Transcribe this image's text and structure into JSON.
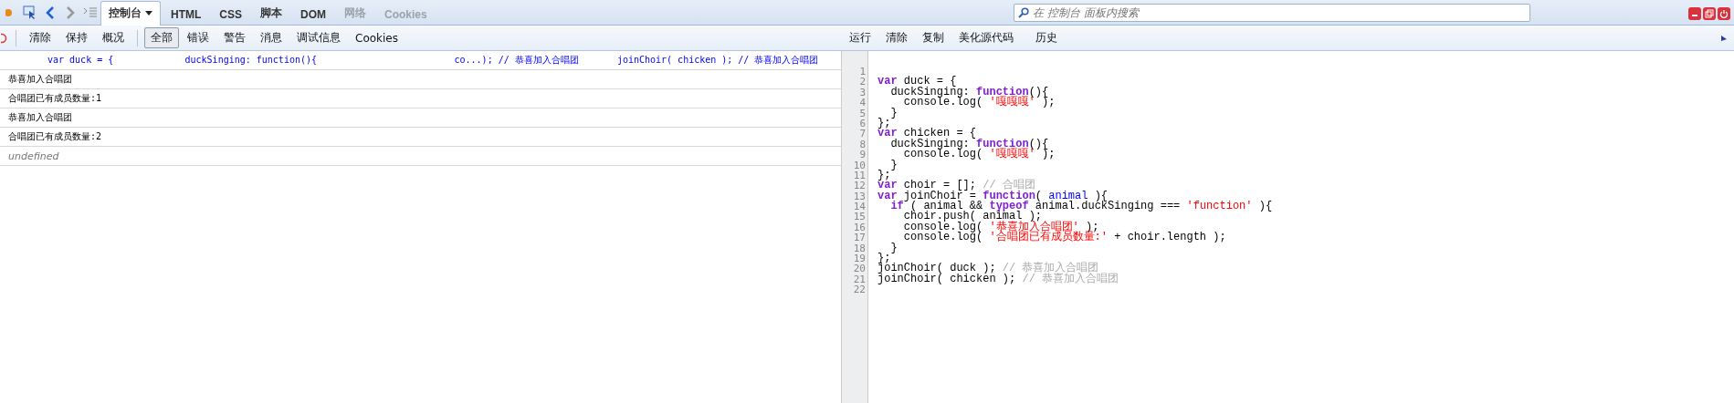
{
  "panel_tabs": [
    {
      "label": "控制台",
      "selected": true,
      "disabled": false,
      "menu": true
    },
    {
      "label": "HTML",
      "selected": false,
      "disabled": false,
      "menu": false
    },
    {
      "label": "CSS",
      "selected": false,
      "disabled": false,
      "menu": false
    },
    {
      "label": "脚本",
      "selected": false,
      "disabled": false,
      "menu": false
    },
    {
      "label": "DOM",
      "selected": false,
      "disabled": false,
      "menu": false
    },
    {
      "label": "网络",
      "selected": false,
      "disabled": true,
      "menu": false
    },
    {
      "label": "Cookies",
      "selected": false,
      "disabled": true,
      "menu": false
    }
  ],
  "search": {
    "placeholder": "在 控制台 面板内搜索"
  },
  "console_toolbar": {
    "actions": [
      "清除",
      "保持",
      "概况"
    ],
    "filters": [
      {
        "label": "全部",
        "selected": true
      },
      {
        "label": "错误",
        "selected": false
      },
      {
        "label": "警告",
        "selected": false
      },
      {
        "label": "消息",
        "selected": false
      },
      {
        "label": "调试信息",
        "selected": false
      },
      {
        "label": "Cookies",
        "selected": false
      }
    ]
  },
  "editor_toolbar": [
    "运行",
    "清除",
    "复制",
    "美化源代码",
    "历史"
  ],
  "console_rows": [
    {
      "kind": "command",
      "text": "var duck = {             duckSinging: function(){                         co...); // 恭喜加入合唱团       joinChoir( chicken ); // 恭喜加入合唱团"
    },
    {
      "kind": "log",
      "text": "恭喜加入合唱团"
    },
    {
      "kind": "log",
      "text": "合唱团已有成员数量:1"
    },
    {
      "kind": "log",
      "text": "恭喜加入合唱团"
    },
    {
      "kind": "log",
      "text": "合唱团已有成员数量:2"
    },
    {
      "kind": "result",
      "text": "undefined"
    }
  ],
  "editor": {
    "lines": [
      {
        "number": "1"
      },
      {
        "number": "2",
        "tokens": [
          {
            "kind": "kw",
            "text": "var"
          },
          {
            "kind": "plain",
            "text": " duck = {"
          }
        ]
      },
      {
        "number": "3",
        "tokens": [
          {
            "kind": "plain",
            "text": "  duckSinging: "
          },
          {
            "kind": "kw",
            "text": "function"
          },
          {
            "kind": "plain",
            "text": "(){"
          }
        ]
      },
      {
        "number": "4",
        "tokens": [
          {
            "kind": "plain",
            "text": "    console.log( "
          },
          {
            "kind": "str",
            "text": "'嘎嘎嘎'"
          },
          {
            "kind": "plain",
            "text": " );"
          }
        ]
      },
      {
        "number": "5",
        "tokens": [
          {
            "kind": "plain",
            "text": "  }"
          }
        ]
      },
      {
        "number": "6",
        "tokens": [
          {
            "kind": "plain",
            "text": "};"
          }
        ]
      },
      {
        "number": "7",
        "tokens": [
          {
            "kind": "kw",
            "text": "var"
          },
          {
            "kind": "plain",
            "text": " chicken = {"
          }
        ]
      },
      {
        "number": "8",
        "tokens": [
          {
            "kind": "plain",
            "text": "  duckSinging: "
          },
          {
            "kind": "kw",
            "text": "function"
          },
          {
            "kind": "plain",
            "text": "(){"
          }
        ]
      },
      {
        "number": "9",
        "tokens": [
          {
            "kind": "plain",
            "text": "    console.log( "
          },
          {
            "kind": "str",
            "text": "'嘎嘎嘎'"
          },
          {
            "kind": "plain",
            "text": " );"
          }
        ]
      },
      {
        "number": "10",
        "tokens": [
          {
            "kind": "plain",
            "text": "  }"
          }
        ]
      },
      {
        "number": "11",
        "tokens": [
          {
            "kind": "plain",
            "text": "};"
          }
        ]
      },
      {
        "number": "12",
        "tokens": [
          {
            "kind": "kw",
            "text": "var"
          },
          {
            "kind": "plain",
            "text": " choir = []; "
          },
          {
            "kind": "comment",
            "text": "// 合唱团"
          }
        ]
      },
      {
        "number": "13",
        "tokens": [
          {
            "kind": "kw",
            "text": "var"
          },
          {
            "kind": "plain",
            "text": " joinChoir = "
          },
          {
            "kind": "kw",
            "text": "function"
          },
          {
            "kind": "plain",
            "text": "( "
          },
          {
            "kind": "param",
            "text": "animal"
          },
          {
            "kind": "plain",
            "text": " ){"
          }
        ]
      },
      {
        "number": "14",
        "tokens": [
          {
            "kind": "kw",
            "text": "  if"
          },
          {
            "kind": "plain",
            "text": " ( animal && "
          },
          {
            "kind": "kw",
            "text": "typeof"
          },
          {
            "kind": "plain",
            "text": " animal.duckSinging === "
          },
          {
            "kind": "str",
            "text": "'function'"
          },
          {
            "kind": "plain",
            "text": " ){"
          }
        ]
      },
      {
        "number": "15",
        "tokens": [
          {
            "kind": "plain",
            "text": "    choir.push( animal );"
          }
        ]
      },
      {
        "number": "16",
        "tokens": [
          {
            "kind": "plain",
            "text": "    console.log( "
          },
          {
            "kind": "str",
            "text": "'恭喜加入合唱团'"
          },
          {
            "kind": "plain",
            "text": " );"
          }
        ]
      },
      {
        "number": "17",
        "tokens": [
          {
            "kind": "plain",
            "text": "    console.log( "
          },
          {
            "kind": "str",
            "text": "'合唱团已有成员数量:'"
          },
          {
            "kind": "plain",
            "text": " + choir.length );"
          }
        ]
      },
      {
        "number": "18",
        "tokens": [
          {
            "kind": "plain",
            "text": "  }"
          }
        ]
      },
      {
        "number": "19",
        "tokens": [
          {
            "kind": "plain",
            "text": "};"
          }
        ]
      },
      {
        "number": "20",
        "tokens": [
          {
            "kind": "plain",
            "text": "joinChoir( duck ); "
          },
          {
            "kind": "comment",
            "text": "// 恭喜加入合唱团"
          }
        ]
      },
      {
        "number": "21",
        "tokens": [
          {
            "kind": "plain",
            "text": "joinChoir( chicken ); "
          },
          {
            "kind": "comment",
            "text": "// 恭喜加入合唱团"
          }
        ]
      },
      {
        "number": "22"
      }
    ]
  }
}
